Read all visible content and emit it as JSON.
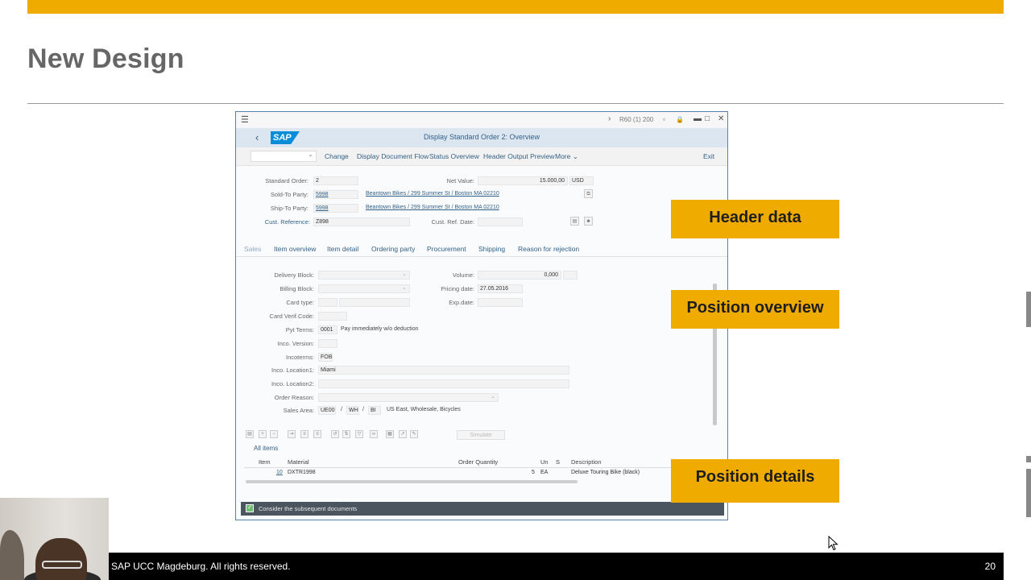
{
  "slide": {
    "title": "New Design",
    "footer_text": "SAP UCC Magdeburg. All rights reserved.",
    "page_number": "20",
    "accent_color": "#f0ab00"
  },
  "callouts": {
    "header_data": "Header data",
    "position_overview": "Position overview",
    "position_details": "Position details"
  },
  "sap": {
    "system_info": "R60 (1) 200",
    "logo": "SAP",
    "screen_title": "Display Standard Order 2: Overview",
    "toolbar": {
      "change": "Change",
      "display_document_flow": "Display Document Flow",
      "status_overview": "Status Overview",
      "header_output_preview": "Header Output Preview",
      "more": "More",
      "exit": "Exit"
    },
    "header": {
      "standard_order_label": "Standard Order:",
      "standard_order_value": "2",
      "net_value_label": "Net Value:",
      "net_value_value": "15.000,00",
      "currency": "USD",
      "sold_to_label": "Sold-To Party:",
      "sold_to_value": "5998",
      "sold_to_desc": "Beantown Bikes / 299 Summer St / Boston MA 02210",
      "ship_to_label": "Ship-To Party:",
      "ship_to_value": "5998",
      "ship_to_desc": "Beantown Bikes / 299 Summer St / Boston MA 02210",
      "cust_ref_label": "Cust. Reference:",
      "cust_ref_value": "Z898",
      "cust_ref_date_label": "Cust. Ref. Date:"
    },
    "tabs": [
      "Sales",
      "Item overview",
      "Item detail",
      "Ordering party",
      "Procurement",
      "Shipping",
      "Reason for rejection"
    ],
    "sales": {
      "delivery_block_label": "Delivery Block:",
      "billing_block_label": "Billing Block:",
      "card_type_label": "Card type:",
      "card_verif_label": "Card Verif.Code:",
      "pyt_terms_label": "Pyt Terms:",
      "pyt_terms_value": "0001",
      "pyt_terms_desc": "Pay immediately w/o deduction",
      "inco_version_label": "Inco. Version:",
      "incoterms_label": "Incoterms:",
      "incoterms_value": "FOB",
      "inco_location1_label": "Inco. Location1:",
      "inco_location1_value": "Miami",
      "inco_location2_label": "Inco. Location2:",
      "order_reason_label": "Order Reason:",
      "sales_area_label": "Sales Area:",
      "sales_area_org": "UE00",
      "sales_area_channel": "WH",
      "sales_area_division": "BI",
      "sales_area_desc": "US East, Wholesale, Bicycles",
      "volume_label": "Volume:",
      "volume_value": "0,000",
      "pricing_date_label": "Pricing date:",
      "pricing_date_value": "27.05.2016",
      "exp_date_label": "Exp.date:"
    },
    "items": {
      "simulate_label": "Simulate",
      "all_items_label": "All items",
      "columns": [
        "Item",
        "Material",
        "Order Quantity",
        "Un",
        "S",
        "Description"
      ],
      "rows": [
        {
          "item": "10",
          "material": "DXTR1998",
          "qty": "5",
          "unit": "EA",
          "status": "",
          "description": "Deluxe Touring Bike (black)"
        }
      ]
    },
    "message": "Consider the subsequent documents"
  }
}
